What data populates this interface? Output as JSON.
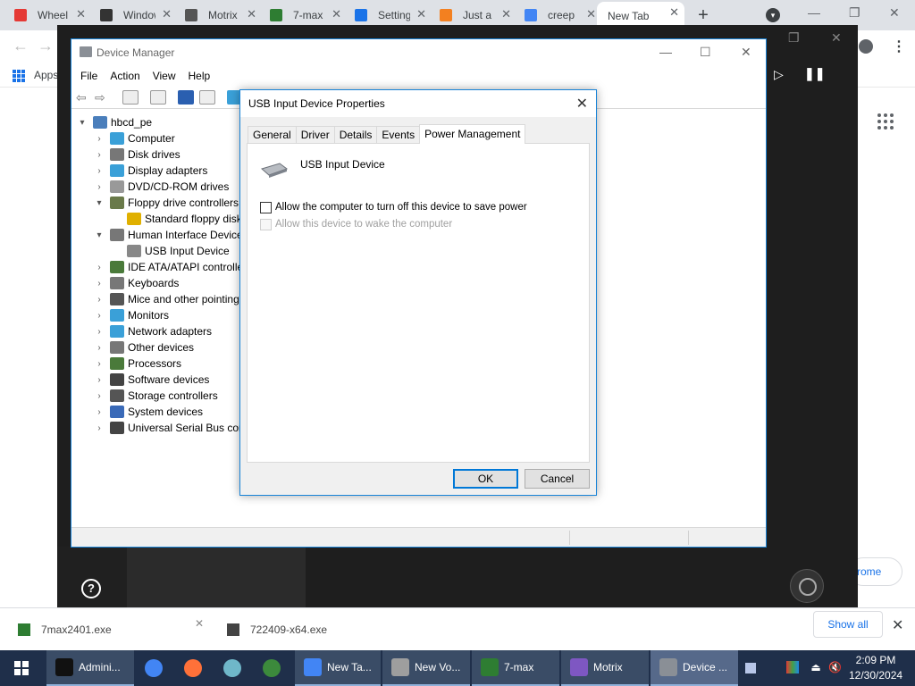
{
  "chrome": {
    "tabs": [
      {
        "title": "Wheel",
        "color": "#e53935"
      },
      {
        "title": "Windows",
        "color": "#333333"
      },
      {
        "title": "Motrix",
        "color": "#555555"
      },
      {
        "title": "7-max",
        "color": "#2e7d32"
      },
      {
        "title": "Settings",
        "color": "#1a73e8"
      },
      {
        "title": "Just a",
        "color": "#f38020"
      },
      {
        "title": "creep",
        "color": "#4285f4"
      }
    ],
    "active_tab": "New Tab",
    "bookmarks_label": "Apps",
    "customize_label": "rome"
  },
  "overlay": {
    "help_icon": "?"
  },
  "device_manager": {
    "title": "Device Manager",
    "menu": [
      "File",
      "Action",
      "View",
      "Help"
    ],
    "tree": [
      {
        "label": "hbcd_pe",
        "chev": "▾",
        "depth": 0,
        "color": "#4a7ebb"
      },
      {
        "label": "Computer",
        "chev": "›",
        "depth": 1,
        "color": "#3aa0d8"
      },
      {
        "label": "Disk drives",
        "chev": "›",
        "depth": 1,
        "color": "#777777"
      },
      {
        "label": "Display adapters",
        "chev": "›",
        "depth": 1,
        "color": "#3aa0d8"
      },
      {
        "label": "DVD/CD-ROM drives",
        "chev": "›",
        "depth": 1,
        "color": "#999999"
      },
      {
        "label": "Floppy drive controllers",
        "chev": "▾",
        "depth": 1,
        "color": "#6a7a4a"
      },
      {
        "label": "Standard floppy disk",
        "chev": "",
        "depth": 2,
        "color": "#e0b000"
      },
      {
        "label": "Human Interface Device",
        "chev": "▾",
        "depth": 1,
        "color": "#777777"
      },
      {
        "label": "USB Input Device",
        "chev": "",
        "depth": 2,
        "color": "#888888"
      },
      {
        "label": "IDE ATA/ATAPI controlle",
        "chev": "›",
        "depth": 1,
        "color": "#4a7a3a"
      },
      {
        "label": "Keyboards",
        "chev": "›",
        "depth": 1,
        "color": "#777777"
      },
      {
        "label": "Mice and other pointing",
        "chev": "›",
        "depth": 1,
        "color": "#555555"
      },
      {
        "label": "Monitors",
        "chev": "›",
        "depth": 1,
        "color": "#3aa0d8"
      },
      {
        "label": "Network adapters",
        "chev": "›",
        "depth": 1,
        "color": "#3aa0d8"
      },
      {
        "label": "Other devices",
        "chev": "›",
        "depth": 1,
        "color": "#777777"
      },
      {
        "label": "Processors",
        "chev": "›",
        "depth": 1,
        "color": "#4a7a3a"
      },
      {
        "label": "Software devices",
        "chev": "›",
        "depth": 1,
        "color": "#444444"
      },
      {
        "label": "Storage controllers",
        "chev": "›",
        "depth": 1,
        "color": "#555555"
      },
      {
        "label": "System devices",
        "chev": "›",
        "depth": 1,
        "color": "#3a6ab8"
      },
      {
        "label": "Universal Serial Bus con",
        "chev": "›",
        "depth": 1,
        "color": "#444444"
      }
    ]
  },
  "properties": {
    "title": "USB Input Device Properties",
    "tabs": [
      "General",
      "Driver",
      "Details",
      "Events",
      "Power Management"
    ],
    "active_tab": "Power Management",
    "device_name": "USB Input Device",
    "options": [
      {
        "label": "Allow the computer to turn off this device to save power",
        "checked": false,
        "disabled": false
      },
      {
        "label": "Allow this device to wake the computer",
        "checked": false,
        "disabled": true
      }
    ],
    "ok_label": "OK",
    "cancel_label": "Cancel"
  },
  "downloads": {
    "items": [
      {
        "name": "7max2401.exe"
      },
      {
        "name": "722409-x64.exe"
      }
    ],
    "show_all_label": "Show all"
  },
  "taskbar": {
    "items": [
      {
        "label": "Admini...",
        "color": "#111111",
        "labeled": true,
        "active": false
      },
      {
        "label": "",
        "color": "#4285f4",
        "labeled": false,
        "active": false
      },
      {
        "label": "",
        "color": "#ff7139",
        "labeled": false,
        "active": false
      },
      {
        "label": "",
        "color": "#6fb7c9",
        "labeled": false,
        "active": false
      },
      {
        "label": "",
        "color": "#3c8a3c",
        "labeled": false,
        "active": false
      },
      {
        "label": "New Ta...",
        "color": "#4285f4",
        "labeled": true,
        "active": false
      },
      {
        "label": "New Vo...",
        "color": "#9e9e9e",
        "labeled": true,
        "active": false
      },
      {
        "label": "7-max",
        "color": "#2e7d32",
        "labeled": true,
        "active": false
      },
      {
        "label": "Motrix",
        "color": "#7e57c2",
        "labeled": true,
        "active": false
      },
      {
        "label": "Device ...",
        "color": "#8a8f96",
        "labeled": true,
        "active": true
      }
    ],
    "clock_time": "2:09 PM",
    "clock_date": "12/30/2024"
  }
}
